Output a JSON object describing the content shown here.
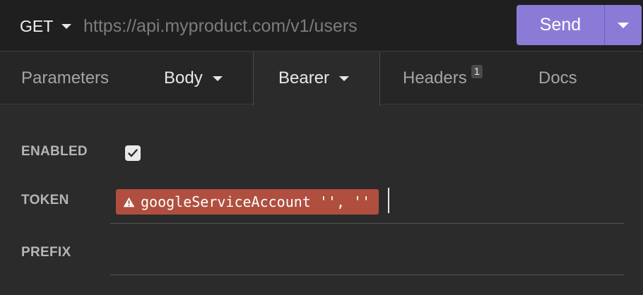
{
  "request": {
    "method": "GET",
    "url_placeholder": "https://api.myproduct.com/v1/users",
    "send_label": "Send"
  },
  "tabs": [
    {
      "label": "Parameters"
    },
    {
      "label": "Body"
    },
    {
      "label": "Bearer"
    },
    {
      "label": "Headers",
      "badge": "1"
    },
    {
      "label": "Docs"
    }
  ],
  "auth": {
    "enabled_label": "ENABLED",
    "enabled": true,
    "token_label": "TOKEN",
    "token_tag": "googleServiceAccount '', ''",
    "token_tag_icon": "warning-icon",
    "prefix_label": "PREFIX",
    "prefix_value": ""
  },
  "colors": {
    "send_button": "#8c7bd6",
    "error_tag": "#b04f3f"
  }
}
